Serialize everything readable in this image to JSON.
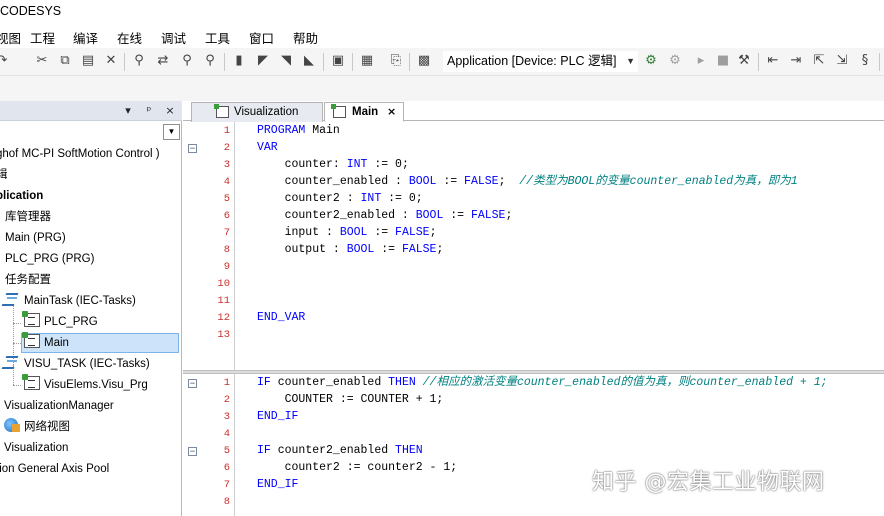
{
  "window": {
    "title": "CODESYS"
  },
  "menu": [
    "视图",
    "工程",
    "编译",
    "在线",
    "调试",
    "工具",
    "窗口",
    "帮助"
  ],
  "toolbar": {
    "active_application": "Application [Device: PLC 逻辑]"
  },
  "devices_panel": {
    "header_buttons": [
      "▾",
      "ᵖ",
      "×"
    ],
    "tree": [
      {
        "label": "ghof MC-PI SoftMotion Control )",
        "icon": ""
      },
      {
        "label": "辑",
        "icon": ""
      },
      {
        "label": "plication",
        "icon": "",
        "bold": true
      },
      {
        "label": "库管理器",
        "icon": "library-icon"
      },
      {
        "label": "Main (PRG)",
        "icon": "pou-icon"
      },
      {
        "label": "PLC_PRG (PRG)",
        "icon": "pou-icon"
      },
      {
        "label": "任务配置",
        "icon": "task-config-icon"
      },
      {
        "label": "MainTask (IEC-Tasks)",
        "icon": "task-icon"
      },
      {
        "label": "PLC_PRG",
        "icon": "pou-icon"
      },
      {
        "label": "Main",
        "icon": "pou-icon",
        "selected": true
      },
      {
        "label": "VISU_TASK (IEC-Tasks)",
        "icon": "task-icon"
      },
      {
        "label": "VisuElems.Visu_Prg",
        "icon": "pou-icon"
      },
      {
        "label": "VisualizationManager",
        "icon": ""
      },
      {
        "label": "网络视图",
        "icon": "network-icon"
      },
      {
        "label": "Visualization",
        "icon": ""
      },
      {
        "label": "tion General Axis Pool",
        "icon": ""
      }
    ]
  },
  "editor_tabs": [
    {
      "label": "Visualization",
      "active": false
    },
    {
      "label": "Main",
      "active": true,
      "close": "×"
    }
  ],
  "declaration": {
    "line_numbers": [
      "1",
      "2",
      "3",
      "4",
      "5",
      "6",
      "7",
      "8",
      "9",
      "10",
      "11",
      "12",
      "13"
    ],
    "lines": [
      "PROGRAM Main",
      "VAR",
      "    counter: INT := 0;",
      "    counter_enabled : BOOL := FALSE;  //类型为BOOL的变量counter_enabled为真，即为1",
      "    counter2 : INT := 0;",
      "    counter2_enabled : BOOL := FALSE;",
      "    input : BOOL := FALSE;",
      "    output : BOOL := FALSE;",
      "",
      "",
      "",
      "END_VAR",
      ""
    ]
  },
  "implementation": {
    "line_numbers": [
      "1",
      "2",
      "3",
      "4",
      "5",
      "6",
      "7",
      "8"
    ],
    "lines": [
      "IF counter_enabled THEN //相应的激活变量counter_enabled的值为真，则counter_enabled + 1;",
      "    COUNTER := COUNTER + 1;",
      "END_IF",
      "",
      "IF counter2_enabled THEN",
      "    counter2 := counter2 - 1;",
      "END_IF",
      ""
    ]
  },
  "watermark": "知乎 @宏集工业物联网"
}
